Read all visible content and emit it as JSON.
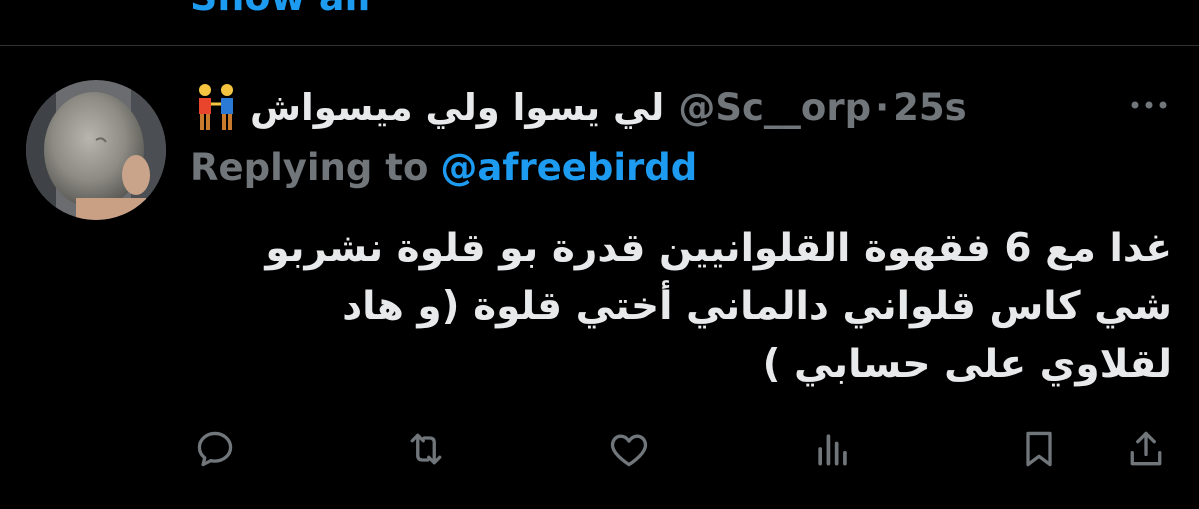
{
  "top": {
    "show_all_label": "Show all"
  },
  "tweet": {
    "avatar_icon": "avatar-photo",
    "emoji_icon": "two-men-holding-hands-icon",
    "display_name": "لي يسوا ولي ميسواش",
    "handle": "@Sc__orp",
    "separator": "·",
    "time": "25s",
    "replying_prefix": "Replying to",
    "replying_to": "@afreebirdd",
    "text_lines": [
      "غدا مع 6 فقهوة القلوانيين قدرة بو قلوة نشربو",
      "شي كاس قلواني دالماني أختي قلوة (و هاد",
      "لقلاوي على حسابي )"
    ]
  },
  "actions": {
    "icons": [
      "reply-icon",
      "retweet-icon",
      "like-icon",
      "views-icon",
      "bookmark-icon",
      "share-icon"
    ]
  },
  "colors": {
    "background": "#000000",
    "text": "#e7e9ea",
    "secondary": "#71767b",
    "accent": "#1d9bf0",
    "divider": "#2f3336"
  }
}
